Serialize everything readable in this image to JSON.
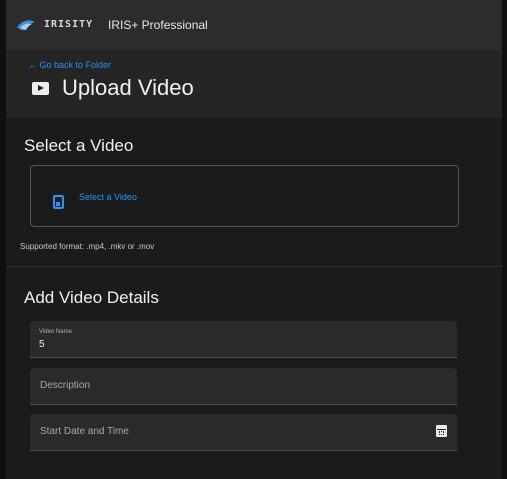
{
  "app": {
    "logo_text": "IRISITY",
    "product_name": "IRIS+ Professional",
    "accent_color": "#2196f3"
  },
  "header": {
    "back_link": "Go back to Folder",
    "back_icon": "arrow-left-icon",
    "title_icon": "video-icon",
    "title": "Upload Video"
  },
  "select_section": {
    "title": "Select a Video",
    "dropzone_icon": "file-upload-icon",
    "dropzone_label": "Select a Video",
    "hint": "Supported format: .mp4, .mkv or .mov"
  },
  "details_section": {
    "title": "Add Video Details",
    "video_name": {
      "label": "Video Name",
      "value": "5"
    },
    "description": {
      "placeholder": "Description"
    },
    "start_date": {
      "placeholder": "Start Date and Time",
      "icon": "calendar-icon"
    }
  }
}
